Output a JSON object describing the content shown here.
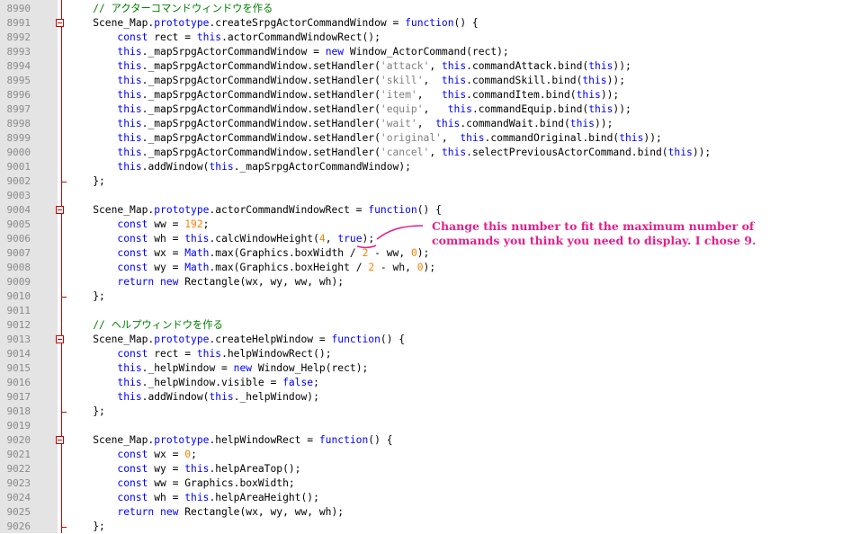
{
  "editor": {
    "lines": [
      {
        "num": "8990",
        "fold": "none",
        "tokens": [
          {
            "t": "    ",
            "c": "pl"
          },
          {
            "t": "// アクターコマンドウィンドウを作る",
            "c": "cm"
          }
        ]
      },
      {
        "num": "8991",
        "fold": "open",
        "tokens": [
          {
            "t": "    Scene_Map.",
            "c": "pl"
          },
          {
            "t": "prototype",
            "c": "kw"
          },
          {
            "t": ".createSrpgActorCommandWindow = ",
            "c": "pl"
          },
          {
            "t": "function",
            "c": "kw"
          },
          {
            "t": "() {",
            "c": "pl"
          }
        ]
      },
      {
        "num": "8992",
        "fold": "none",
        "tokens": [
          {
            "t": "        ",
            "c": "pl"
          },
          {
            "t": "const",
            "c": "kw"
          },
          {
            "t": " rect = ",
            "c": "pl"
          },
          {
            "t": "this",
            "c": "kw"
          },
          {
            "t": ".actorCommandWindowRect();",
            "c": "pl"
          }
        ]
      },
      {
        "num": "8993",
        "fold": "none",
        "tokens": [
          {
            "t": "        ",
            "c": "pl"
          },
          {
            "t": "this",
            "c": "kw"
          },
          {
            "t": "._mapSrpgActorCommandWindow = ",
            "c": "pl"
          },
          {
            "t": "new",
            "c": "kw"
          },
          {
            "t": " Window_ActorCommand(rect);",
            "c": "pl"
          }
        ]
      },
      {
        "num": "8994",
        "fold": "none",
        "tokens": [
          {
            "t": "        ",
            "c": "pl"
          },
          {
            "t": "this",
            "c": "kw"
          },
          {
            "t": "._mapSrpgActorCommandWindow.setHandler(",
            "c": "pl"
          },
          {
            "t": "'attack'",
            "c": "str"
          },
          {
            "t": ", ",
            "c": "pl"
          },
          {
            "t": "this",
            "c": "kw"
          },
          {
            "t": ".commandAttack.bind(",
            "c": "pl"
          },
          {
            "t": "this",
            "c": "kw"
          },
          {
            "t": "));",
            "c": "pl"
          }
        ]
      },
      {
        "num": "8995",
        "fold": "none",
        "tokens": [
          {
            "t": "        ",
            "c": "pl"
          },
          {
            "t": "this",
            "c": "kw"
          },
          {
            "t": "._mapSrpgActorCommandWindow.setHandler(",
            "c": "pl"
          },
          {
            "t": "'skill'",
            "c": "str"
          },
          {
            "t": ",  ",
            "c": "pl"
          },
          {
            "t": "this",
            "c": "kw"
          },
          {
            "t": ".commandSkill.bind(",
            "c": "pl"
          },
          {
            "t": "this",
            "c": "kw"
          },
          {
            "t": "));",
            "c": "pl"
          }
        ]
      },
      {
        "num": "8996",
        "fold": "none",
        "tokens": [
          {
            "t": "        ",
            "c": "pl"
          },
          {
            "t": "this",
            "c": "kw"
          },
          {
            "t": "._mapSrpgActorCommandWindow.setHandler(",
            "c": "pl"
          },
          {
            "t": "'item'",
            "c": "str"
          },
          {
            "t": ",   ",
            "c": "pl"
          },
          {
            "t": "this",
            "c": "kw"
          },
          {
            "t": ".commandItem.bind(",
            "c": "pl"
          },
          {
            "t": "this",
            "c": "kw"
          },
          {
            "t": "));",
            "c": "pl"
          }
        ]
      },
      {
        "num": "8997",
        "fold": "none",
        "tokens": [
          {
            "t": "        ",
            "c": "pl"
          },
          {
            "t": "this",
            "c": "kw"
          },
          {
            "t": "._mapSrpgActorCommandWindow.setHandler(",
            "c": "pl"
          },
          {
            "t": "'equip'",
            "c": "str"
          },
          {
            "t": ",   ",
            "c": "pl"
          },
          {
            "t": "this",
            "c": "kw"
          },
          {
            "t": ".commandEquip.bind(",
            "c": "pl"
          },
          {
            "t": "this",
            "c": "kw"
          },
          {
            "t": "));",
            "c": "pl"
          }
        ]
      },
      {
        "num": "8998",
        "fold": "none",
        "tokens": [
          {
            "t": "        ",
            "c": "pl"
          },
          {
            "t": "this",
            "c": "kw"
          },
          {
            "t": "._mapSrpgActorCommandWindow.setHandler(",
            "c": "pl"
          },
          {
            "t": "'wait'",
            "c": "str"
          },
          {
            "t": ",  ",
            "c": "pl"
          },
          {
            "t": "this",
            "c": "kw"
          },
          {
            "t": ".commandWait.bind(",
            "c": "pl"
          },
          {
            "t": "this",
            "c": "kw"
          },
          {
            "t": "));",
            "c": "pl"
          }
        ]
      },
      {
        "num": "8999",
        "fold": "none",
        "tokens": [
          {
            "t": "        ",
            "c": "pl"
          },
          {
            "t": "this",
            "c": "kw"
          },
          {
            "t": "._mapSrpgActorCommandWindow.setHandler(",
            "c": "pl"
          },
          {
            "t": "'original'",
            "c": "str"
          },
          {
            "t": ",  ",
            "c": "pl"
          },
          {
            "t": "this",
            "c": "kw"
          },
          {
            "t": ".commandOriginal.bind(",
            "c": "pl"
          },
          {
            "t": "this",
            "c": "kw"
          },
          {
            "t": "));",
            "c": "pl"
          }
        ]
      },
      {
        "num": "9000",
        "fold": "none",
        "tokens": [
          {
            "t": "        ",
            "c": "pl"
          },
          {
            "t": "this",
            "c": "kw"
          },
          {
            "t": "._mapSrpgActorCommandWindow.setHandler(",
            "c": "pl"
          },
          {
            "t": "'cancel'",
            "c": "str"
          },
          {
            "t": ", ",
            "c": "pl"
          },
          {
            "t": "this",
            "c": "kw"
          },
          {
            "t": ".selectPreviousActorCommand.bind(",
            "c": "pl"
          },
          {
            "t": "this",
            "c": "kw"
          },
          {
            "t": "));",
            "c": "pl"
          }
        ]
      },
      {
        "num": "9001",
        "fold": "none",
        "tokens": [
          {
            "t": "        ",
            "c": "pl"
          },
          {
            "t": "this",
            "c": "kw"
          },
          {
            "t": ".addWindow(",
            "c": "pl"
          },
          {
            "t": "this",
            "c": "kw"
          },
          {
            "t": "._mapSrpgActorCommandWindow);",
            "c": "pl"
          }
        ]
      },
      {
        "num": "9002",
        "fold": "end",
        "tokens": [
          {
            "t": "    };",
            "c": "pl"
          }
        ]
      },
      {
        "num": "9003",
        "fold": "none",
        "tokens": []
      },
      {
        "num": "9004",
        "fold": "open",
        "tokens": [
          {
            "t": "    Scene_Map.",
            "c": "pl"
          },
          {
            "t": "prototype",
            "c": "kw"
          },
          {
            "t": ".actorCommandWindowRect = ",
            "c": "pl"
          },
          {
            "t": "function",
            "c": "kw"
          },
          {
            "t": "() {",
            "c": "pl"
          }
        ]
      },
      {
        "num": "9005",
        "fold": "none",
        "tokens": [
          {
            "t": "        ",
            "c": "pl"
          },
          {
            "t": "const",
            "c": "kw"
          },
          {
            "t": " ww = ",
            "c": "pl"
          },
          {
            "t": "192",
            "c": "num"
          },
          {
            "t": ";",
            "c": "pl"
          }
        ]
      },
      {
        "num": "9006",
        "fold": "none",
        "tokens": [
          {
            "t": "        ",
            "c": "pl"
          },
          {
            "t": "const",
            "c": "kw"
          },
          {
            "t": " wh = ",
            "c": "pl"
          },
          {
            "t": "this",
            "c": "kw"
          },
          {
            "t": ".calcWindowHeight(",
            "c": "pl"
          },
          {
            "t": "4",
            "c": "num"
          },
          {
            "t": ", ",
            "c": "pl"
          },
          {
            "t": "true",
            "c": "kw"
          },
          {
            "t": ");",
            "c": "pl"
          }
        ]
      },
      {
        "num": "9007",
        "fold": "none",
        "tokens": [
          {
            "t": "        ",
            "c": "pl"
          },
          {
            "t": "const",
            "c": "kw"
          },
          {
            "t": " wx = ",
            "c": "pl"
          },
          {
            "t": "Math",
            "c": "kw"
          },
          {
            "t": ".max(Graphics.boxWidth / ",
            "c": "pl"
          },
          {
            "t": "2",
            "c": "num"
          },
          {
            "t": " - ww, ",
            "c": "pl"
          },
          {
            "t": "0",
            "c": "num"
          },
          {
            "t": ");",
            "c": "pl"
          }
        ]
      },
      {
        "num": "9008",
        "fold": "none",
        "tokens": [
          {
            "t": "        ",
            "c": "pl"
          },
          {
            "t": "const",
            "c": "kw"
          },
          {
            "t": " wy = ",
            "c": "pl"
          },
          {
            "t": "Math",
            "c": "kw"
          },
          {
            "t": ".max(Graphics.boxHeight / ",
            "c": "pl"
          },
          {
            "t": "2",
            "c": "num"
          },
          {
            "t": " - wh, ",
            "c": "pl"
          },
          {
            "t": "0",
            "c": "num"
          },
          {
            "t": ");",
            "c": "pl"
          }
        ]
      },
      {
        "num": "9009",
        "fold": "none",
        "tokens": [
          {
            "t": "        ",
            "c": "pl"
          },
          {
            "t": "return",
            "c": "kw"
          },
          {
            "t": " ",
            "c": "pl"
          },
          {
            "t": "new",
            "c": "kw"
          },
          {
            "t": " Rectangle(wx, wy, ww, wh);",
            "c": "pl"
          }
        ]
      },
      {
        "num": "9010",
        "fold": "end",
        "tokens": [
          {
            "t": "    };",
            "c": "pl"
          }
        ]
      },
      {
        "num": "9011",
        "fold": "none",
        "tokens": []
      },
      {
        "num": "9012",
        "fold": "none",
        "tokens": [
          {
            "t": "    ",
            "c": "pl"
          },
          {
            "t": "// ヘルプウィンドウを作る",
            "c": "cm"
          }
        ]
      },
      {
        "num": "9013",
        "fold": "open",
        "tokens": [
          {
            "t": "    Scene_Map.",
            "c": "pl"
          },
          {
            "t": "prototype",
            "c": "kw"
          },
          {
            "t": ".createHelpWindow = ",
            "c": "pl"
          },
          {
            "t": "function",
            "c": "kw"
          },
          {
            "t": "() {",
            "c": "pl"
          }
        ]
      },
      {
        "num": "9014",
        "fold": "none",
        "tokens": [
          {
            "t": "        ",
            "c": "pl"
          },
          {
            "t": "const",
            "c": "kw"
          },
          {
            "t": " rect = ",
            "c": "pl"
          },
          {
            "t": "this",
            "c": "kw"
          },
          {
            "t": ".helpWindowRect();",
            "c": "pl"
          }
        ]
      },
      {
        "num": "9015",
        "fold": "none",
        "tokens": [
          {
            "t": "        ",
            "c": "pl"
          },
          {
            "t": "this",
            "c": "kw"
          },
          {
            "t": "._helpWindow = ",
            "c": "pl"
          },
          {
            "t": "new",
            "c": "kw"
          },
          {
            "t": " Window_Help(rect);",
            "c": "pl"
          }
        ]
      },
      {
        "num": "9016",
        "fold": "none",
        "tokens": [
          {
            "t": "        ",
            "c": "pl"
          },
          {
            "t": "this",
            "c": "kw"
          },
          {
            "t": "._helpWindow.visible = ",
            "c": "pl"
          },
          {
            "t": "false",
            "c": "kw"
          },
          {
            "t": ";",
            "c": "pl"
          }
        ]
      },
      {
        "num": "9017",
        "fold": "none",
        "tokens": [
          {
            "t": "        ",
            "c": "pl"
          },
          {
            "t": "this",
            "c": "kw"
          },
          {
            "t": ".addWindow(",
            "c": "pl"
          },
          {
            "t": "this",
            "c": "kw"
          },
          {
            "t": "._helpWindow);",
            "c": "pl"
          }
        ]
      },
      {
        "num": "9018",
        "fold": "end",
        "tokens": [
          {
            "t": "    };",
            "c": "pl"
          }
        ]
      },
      {
        "num": "9019",
        "fold": "none",
        "tokens": []
      },
      {
        "num": "9020",
        "fold": "open",
        "tokens": [
          {
            "t": "    Scene_Map.",
            "c": "pl"
          },
          {
            "t": "prototype",
            "c": "kw"
          },
          {
            "t": ".helpWindowRect = ",
            "c": "pl"
          },
          {
            "t": "function",
            "c": "kw"
          },
          {
            "t": "() {",
            "c": "pl"
          }
        ]
      },
      {
        "num": "9021",
        "fold": "none",
        "tokens": [
          {
            "t": "        ",
            "c": "pl"
          },
          {
            "t": "const",
            "c": "kw"
          },
          {
            "t": " wx = ",
            "c": "pl"
          },
          {
            "t": "0",
            "c": "num"
          },
          {
            "t": ";",
            "c": "pl"
          }
        ]
      },
      {
        "num": "9022",
        "fold": "none",
        "tokens": [
          {
            "t": "        ",
            "c": "pl"
          },
          {
            "t": "const",
            "c": "kw"
          },
          {
            "t": " wy = ",
            "c": "pl"
          },
          {
            "t": "this",
            "c": "kw"
          },
          {
            "t": ".helpAreaTop();",
            "c": "pl"
          }
        ]
      },
      {
        "num": "9023",
        "fold": "none",
        "tokens": [
          {
            "t": "        ",
            "c": "pl"
          },
          {
            "t": "const",
            "c": "kw"
          },
          {
            "t": " ww = Graphics.boxWidth;",
            "c": "pl"
          }
        ]
      },
      {
        "num": "9024",
        "fold": "none",
        "tokens": [
          {
            "t": "        ",
            "c": "pl"
          },
          {
            "t": "const",
            "c": "kw"
          },
          {
            "t": " wh = ",
            "c": "pl"
          },
          {
            "t": "this",
            "c": "kw"
          },
          {
            "t": ".helpAreaHeight();",
            "c": "pl"
          }
        ]
      },
      {
        "num": "9025",
        "fold": "none",
        "tokens": [
          {
            "t": "        ",
            "c": "pl"
          },
          {
            "t": "return",
            "c": "kw"
          },
          {
            "t": " ",
            "c": "pl"
          },
          {
            "t": "new",
            "c": "kw"
          },
          {
            "t": " Rectangle(wx, wy, ww, wh);",
            "c": "pl"
          }
        ]
      },
      {
        "num": "9026",
        "fold": "end",
        "tokens": [
          {
            "t": "    };",
            "c": "pl"
          }
        ]
      }
    ]
  },
  "annotation": {
    "line1": "Change this number to fit the maximum number of",
    "line2": "commands you think you need to display. I chose 9.",
    "color": "#e0208a"
  },
  "colors": {
    "keyword": "#0000ff",
    "comment": "#008000",
    "string": "#808080",
    "number": "#ff8000",
    "fold_marker": "#cc0000",
    "gutter": "#e4e4e4"
  }
}
